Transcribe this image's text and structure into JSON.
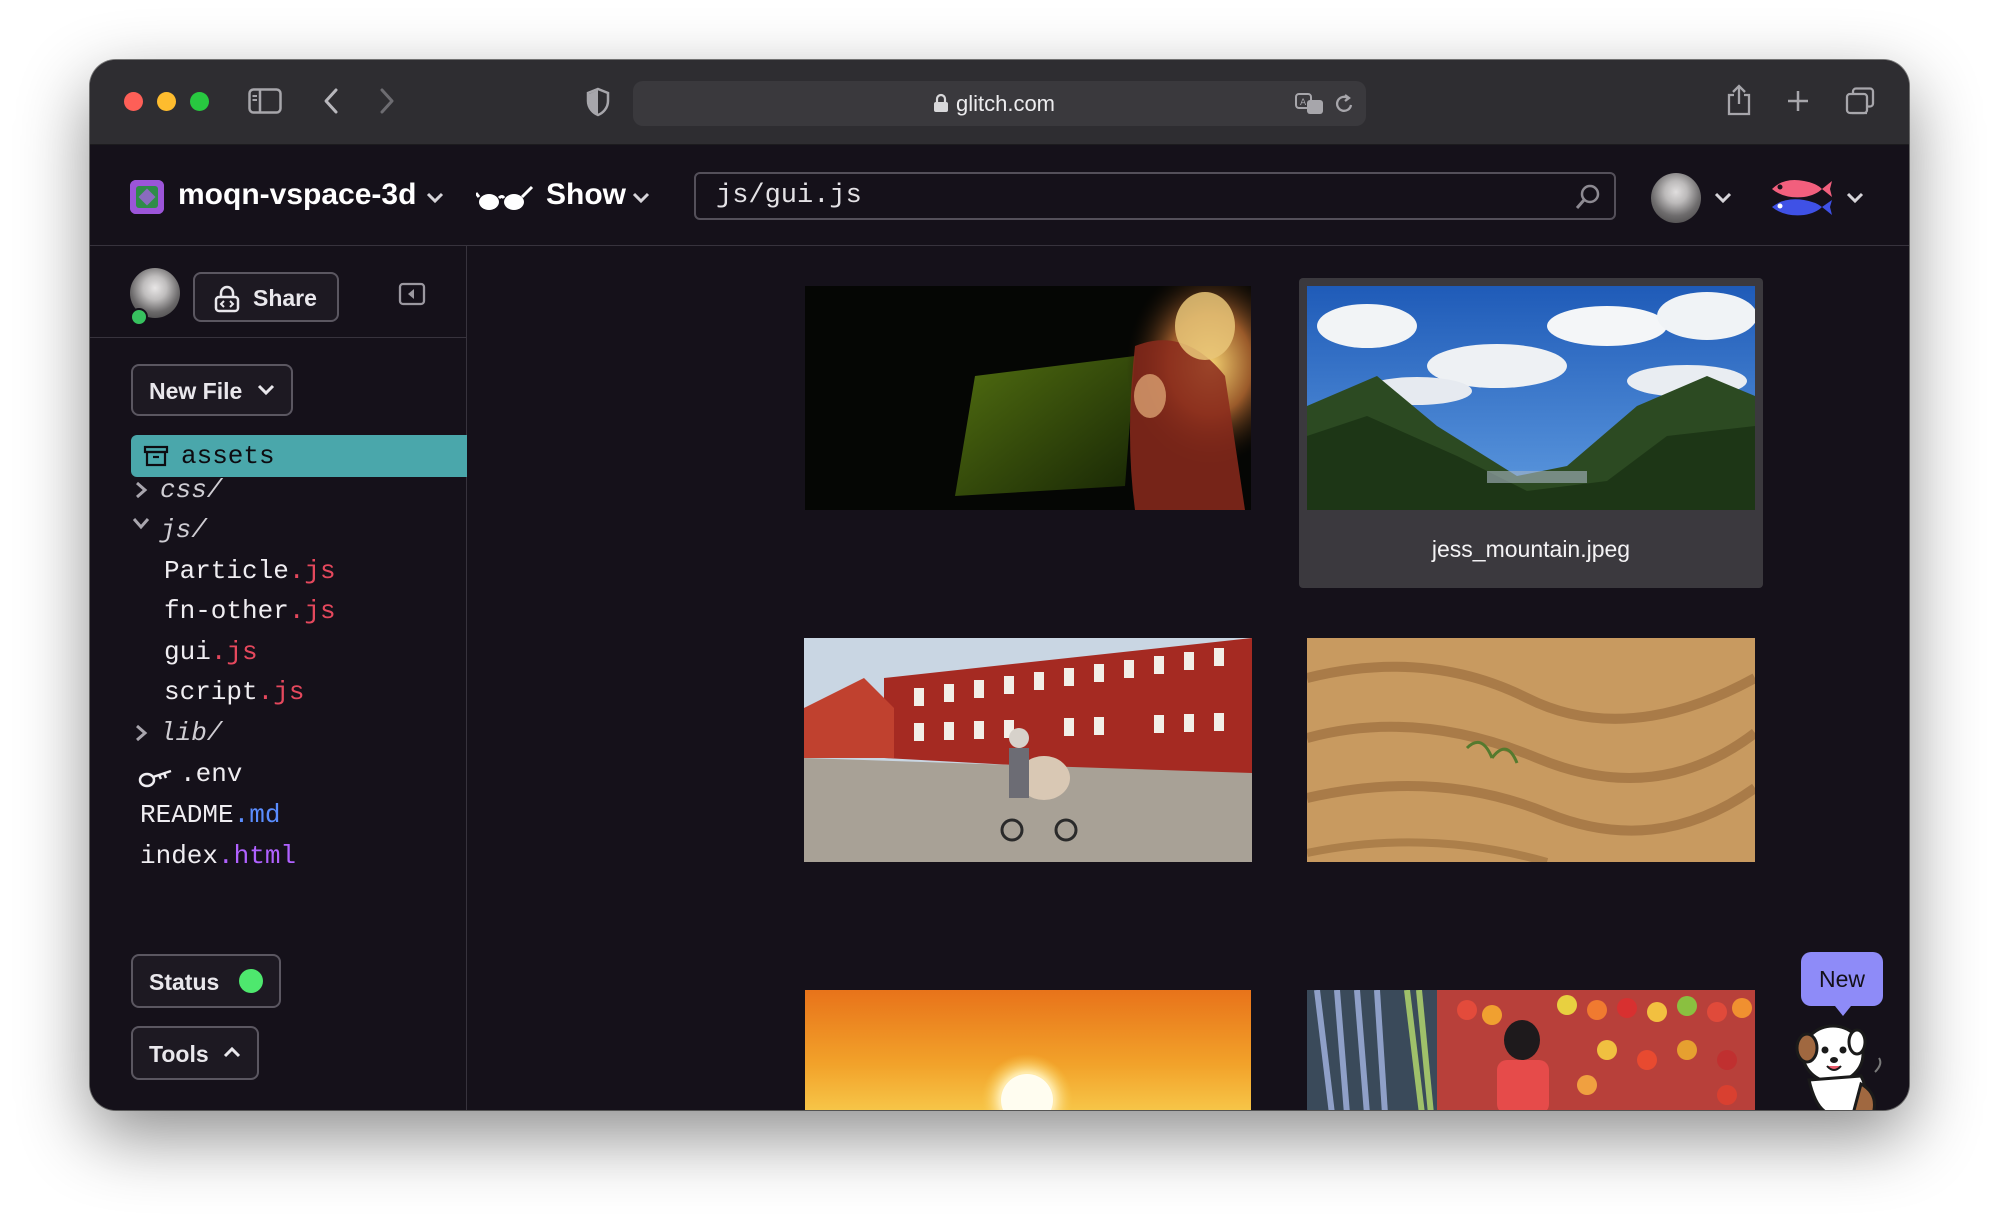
{
  "browser": {
    "url": "glitch.com"
  },
  "header": {
    "project_name": "moqn-vspace-3d",
    "show_label": "Show",
    "search_value": "js/gui.js"
  },
  "sidebar": {
    "share_label": "Share",
    "new_file_label": "New File",
    "assets_label": "assets",
    "tree": {
      "css": "css/",
      "js": "js/",
      "particle": {
        "name": "Particle",
        "ext": ".js"
      },
      "fn_other": {
        "name": "fn-other",
        "ext": ".js"
      },
      "gui": {
        "name": "gui",
        "ext": ".js"
      },
      "script": {
        "name": "script",
        "ext": ".js"
      },
      "lib": "lib/",
      "env": ".env",
      "readme": {
        "name": "README",
        "ext": ".md"
      },
      "index": {
        "name": "index",
        "ext": ".html"
      }
    },
    "status_label": "Status",
    "tools_label": "Tools"
  },
  "assets": {
    "hovered_label": "jess_mountain.jpeg"
  },
  "new_badge": "New",
  "colors": {
    "assets_highlight": "#4aa7ab",
    "status_online": "#4ee86e",
    "new_badge": "#8e8bf8",
    "js_ext": "#e5485d",
    "md_ext": "#5a8dff",
    "html_ext": "#b061ff"
  }
}
